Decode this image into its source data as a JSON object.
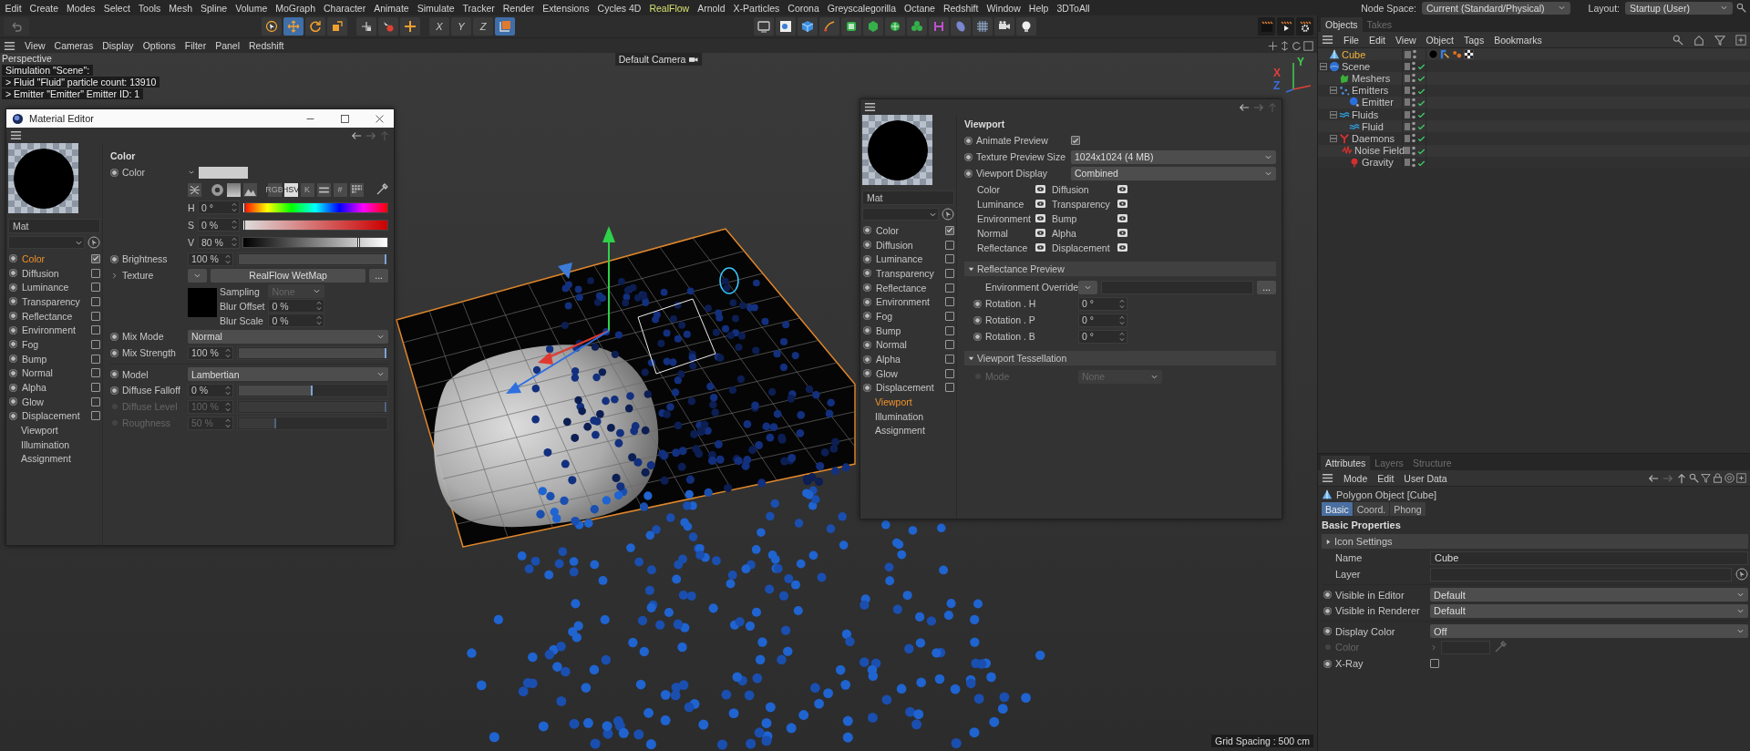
{
  "menu_bar": {
    "items": [
      {
        "label": "Edit"
      },
      {
        "label": "Create"
      },
      {
        "label": "Modes"
      },
      {
        "label": "Select"
      },
      {
        "label": "Tools"
      },
      {
        "label": "Mesh"
      },
      {
        "label": "Spline"
      },
      {
        "label": "Volume"
      },
      {
        "label": "MoGraph"
      },
      {
        "label": "Character"
      },
      {
        "label": "Animate"
      },
      {
        "label": "Simulate"
      },
      {
        "label": "Tracker"
      },
      {
        "label": "Render"
      },
      {
        "label": "Extensions"
      },
      {
        "label": "Cycles 4D"
      },
      {
        "label": "RealFlow",
        "highlighted": true
      },
      {
        "label": "Arnold"
      },
      {
        "label": "X-Particles"
      },
      {
        "label": "Corona"
      },
      {
        "label": "Greyscalegorilla"
      },
      {
        "label": "Octane"
      },
      {
        "label": "Redshift"
      },
      {
        "label": "Window"
      },
      {
        "label": "Help"
      },
      {
        "label": "3DToAll"
      }
    ],
    "node_space": {
      "label": "Node Space:",
      "value": "Current (Standard/Physical)"
    },
    "layout": {
      "label": "Layout:",
      "value": "Startup (User)"
    }
  },
  "toolbar": {
    "tools": [
      {
        "kind": "select",
        "selected": false
      },
      {
        "kind": "move",
        "selected": true
      },
      {
        "kind": "rotate",
        "selected": false
      },
      {
        "kind": "scale",
        "selected": false
      }
    ],
    "axis_locks": [
      {
        "label": "X",
        "selected": false
      },
      {
        "label": "Y",
        "selected": false
      },
      {
        "label": "Z",
        "selected": false
      }
    ],
    "coordinate_system": {
      "selected": true
    }
  },
  "viewport": {
    "menu": [
      "View",
      "Cameras",
      "Display",
      "Options",
      "Filter",
      "Panel",
      "Redshift"
    ],
    "view_name": "Perspective",
    "hud_lines": [
      "Simulation \"Scene\":",
      "> Fluid \"Fluid\" particle count: 13910",
      "> Emitter \"Emitter\" Emitter ID: 1"
    ],
    "camera": "Default Camera",
    "grid_spacing": "Grid Spacing : 500 cm",
    "axis_labels": [
      {
        "label": "Y",
        "color": "#3fcf4f"
      },
      {
        "label": "X",
        "color": "#e0403a"
      },
      {
        "label": "Z",
        "color": "#3b6fe0"
      }
    ]
  },
  "material_editor": {
    "title": "Material Editor",
    "preview_name": "Mat",
    "channels": [
      {
        "kind": "channel",
        "label": "Color",
        "checked": true,
        "selected": true
      },
      {
        "kind": "channel",
        "label": "Diffusion",
        "checked": false,
        "selected": false
      },
      {
        "kind": "channel",
        "label": "Luminance",
        "checked": false,
        "selected": false
      },
      {
        "kind": "channel",
        "label": "Transparency",
        "checked": false,
        "selected": false
      },
      {
        "kind": "channel",
        "label": "Reflectance",
        "checked": false,
        "selected": false
      },
      {
        "kind": "channel",
        "label": "Environment",
        "checked": false,
        "selected": false
      },
      {
        "kind": "channel",
        "label": "Fog",
        "checked": false,
        "selected": false
      },
      {
        "kind": "channel",
        "label": "Bump",
        "checked": false,
        "selected": false
      },
      {
        "kind": "channel",
        "label": "Normal",
        "checked": false,
        "selected": false
      },
      {
        "kind": "channel",
        "label": "Alpha",
        "checked": false,
        "selected": false
      },
      {
        "kind": "channel",
        "label": "Glow",
        "checked": false,
        "selected": false
      },
      {
        "kind": "channel",
        "label": "Displacement",
        "checked": false,
        "selected": false
      },
      {
        "kind": "page",
        "label": "Viewport",
        "selected": false
      },
      {
        "kind": "page",
        "label": "Illumination",
        "selected": false
      },
      {
        "kind": "page",
        "label": "Assignment",
        "selected": false
      }
    ],
    "section_title": "Color",
    "color": {
      "label": "Color",
      "modes": [
        {
          "label": "RGB",
          "selected": false
        },
        {
          "label": "HSV",
          "selected": true
        },
        {
          "label": "K",
          "selected": false
        },
        {
          "label": "#",
          "selected": false
        }
      ],
      "hsv": [
        {
          "label": "H",
          "value": "0 °",
          "level": 0
        },
        {
          "label": "S",
          "value": "0 %",
          "level": 0
        },
        {
          "label": "V",
          "value": "80 %",
          "level": 0.8
        }
      ]
    },
    "params": [
      {
        "kind": "slider",
        "label": "Brightness",
        "value": "100 %",
        "level": 1,
        "disabled": false
      },
      {
        "kind": "texture",
        "label": "Texture",
        "value": "RealFlow WetMap",
        "browse_label": "...",
        "sampling": {
          "label": "Sampling",
          "value": "None"
        },
        "blur": [
          {
            "label": "Blur Offset",
            "value": "0 %"
          },
          {
            "label": "Blur Scale",
            "value": "0 %"
          }
        ]
      },
      {
        "kind": "dropdown",
        "label": "Mix Mode",
        "value": "Normal",
        "disabled": false
      },
      {
        "kind": "slider",
        "label": "Mix Strength",
        "value": "100 %",
        "level": 1,
        "disabled": false
      },
      {
        "kind": "dropdown",
        "label": "Model",
        "value": "Lambertian",
        "disabled": false,
        "divider_above": true
      },
      {
        "kind": "slider",
        "label": "Diffuse Falloff",
        "value": "0 %",
        "level": 0.5,
        "disabled": false
      },
      {
        "kind": "slider",
        "label": "Diffuse Level",
        "value": "100 %",
        "level": 1,
        "disabled": true
      },
      {
        "kind": "slider",
        "label": "Roughness",
        "value": "50 %",
        "level": 0.25,
        "disabled": true
      }
    ]
  },
  "material_panel": {
    "preview_name": "Mat",
    "channels": [
      {
        "kind": "channel",
        "label": "Color",
        "checked": true,
        "selected": false
      },
      {
        "kind": "channel",
        "label": "Diffusion",
        "checked": false,
        "selected": false
      },
      {
        "kind": "channel",
        "label": "Luminance",
        "checked": false,
        "selected": false
      },
      {
        "kind": "channel",
        "label": "Transparency",
        "checked": false,
        "selected": false
      },
      {
        "kind": "channel",
        "label": "Reflectance",
        "checked": false,
        "selected": false
      },
      {
        "kind": "channel",
        "label": "Environment",
        "checked": false,
        "selected": false
      },
      {
        "kind": "channel",
        "label": "Fog",
        "checked": false,
        "selected": false
      },
      {
        "kind": "channel",
        "label": "Bump",
        "checked": false,
        "selected": false
      },
      {
        "kind": "channel",
        "label": "Normal",
        "checked": false,
        "selected": false
      },
      {
        "kind": "channel",
        "label": "Alpha",
        "checked": false,
        "selected": false
      },
      {
        "kind": "channel",
        "label": "Glow",
        "checked": false,
        "selected": false
      },
      {
        "kind": "channel",
        "label": "Displacement",
        "checked": false,
        "selected": false
      },
      {
        "kind": "page",
        "label": "Viewport",
        "selected": true
      },
      {
        "kind": "page",
        "label": "Illumination",
        "selected": false
      },
      {
        "kind": "page",
        "label": "Assignment",
        "selected": false
      }
    ],
    "section_title": "Viewport",
    "params": [
      {
        "kind": "checkbox",
        "label": "Animate Preview",
        "checked": true
      },
      {
        "kind": "dropdown",
        "label": "Texture Preview Size",
        "value": "1024x1024 (4 MB)",
        "disabled": false
      },
      {
        "kind": "dropdown",
        "label": "Viewport Display",
        "value": "Combined",
        "disabled": false
      }
    ],
    "visibility": [
      {
        "label": "Color",
        "visible": true
      },
      {
        "label": "Diffusion",
        "visible": true
      },
      {
        "label": "Luminance",
        "visible": true
      },
      {
        "label": "Transparency",
        "visible": true
      },
      {
        "label": "Environment",
        "visible": true
      },
      {
        "label": "Bump",
        "visible": true
      },
      {
        "label": "Normal",
        "visible": true
      },
      {
        "label": "Alpha",
        "visible": true
      },
      {
        "label": "Reflectance",
        "visible": true
      },
      {
        "label": "Displacement",
        "visible": true
      }
    ],
    "groups": [
      {
        "title": "Reflectance Preview",
        "expanded": true,
        "rows": [
          {
            "kind": "link",
            "label": "Environment Override",
            "browse_label": "..."
          },
          {
            "kind": "number",
            "label": "Rotation . H",
            "value": "0 °"
          },
          {
            "kind": "number",
            "label": "Rotation . P",
            "value": "0 °"
          },
          {
            "kind": "number",
            "label": "Rotation . B",
            "value": "0 °"
          }
        ]
      },
      {
        "title": "Viewport Tessellation",
        "expanded": true,
        "rows": [
          {
            "kind": "dropdown",
            "label": "Mode",
            "value": "None",
            "disabled": true
          }
        ]
      }
    ]
  },
  "objects_panel": {
    "tabs": [
      {
        "label": "Objects",
        "selected": true
      },
      {
        "label": "Takes",
        "selected": false
      }
    ],
    "menu": [
      "File",
      "Edit",
      "View",
      "Object",
      "Tags",
      "Bookmarks"
    ],
    "tree": [
      {
        "name": "Cube",
        "kind": "polygon",
        "selected": true,
        "checked": false,
        "tags": [
          {
            "kind": "material"
          },
          {
            "kind": "wetmap"
          },
          {
            "kind": "particles"
          },
          {
            "kind": "checker"
          }
        ]
      },
      {
        "name": "Scene",
        "kind": "scene",
        "selected": false,
        "checked": true,
        "expanded": true,
        "children": [
          {
            "name": "Meshers",
            "kind": "mesher",
            "selected": false,
            "checked": true
          },
          {
            "name": "Emitters",
            "kind": "emitters",
            "selected": false,
            "checked": true,
            "expanded": true,
            "children": [
              {
                "name": "Emitter",
                "kind": "emitter",
                "selected": false,
                "checked": true
              }
            ]
          },
          {
            "name": "Fluids",
            "kind": "fluids",
            "selected": false,
            "checked": true,
            "expanded": true,
            "children": [
              {
                "name": "Fluid",
                "kind": "fluid",
                "selected": false,
                "checked": true
              }
            ]
          },
          {
            "name": "Daemons",
            "kind": "daemons",
            "selected": false,
            "checked": true,
            "expanded": true,
            "children": [
              {
                "name": "Noise Field",
                "kind": "noise",
                "selected": false,
                "checked": true
              },
              {
                "name": "Gravity",
                "kind": "gravity",
                "selected": false,
                "checked": true
              }
            ]
          }
        ]
      }
    ]
  },
  "attributes_panel": {
    "tabs": [
      {
        "label": "Attributes",
        "selected": true
      },
      {
        "label": "Layers",
        "selected": false
      },
      {
        "label": "Structure",
        "selected": false
      }
    ],
    "menu": [
      "Mode",
      "Edit",
      "User Data"
    ],
    "object_title": "Polygon Object [Cube]",
    "subtabs": [
      {
        "label": "Basic",
        "selected": true
      },
      {
        "label": "Coord.",
        "selected": false
      },
      {
        "label": "Phong",
        "selected": false
      }
    ],
    "section_title": "Basic Properties",
    "group": {
      "title": "Icon Settings",
      "expanded": false
    },
    "rows": [
      {
        "kind": "text",
        "label": "Name",
        "value": "Cube"
      },
      {
        "kind": "link",
        "label": "Layer"
      },
      {
        "kind": "dropdown",
        "label": "Visible in Editor",
        "value": "Default",
        "disabled": false,
        "divider_above": true
      },
      {
        "kind": "dropdown",
        "label": "Visible in Renderer",
        "value": "Default",
        "disabled": false
      },
      {
        "kind": "dropdown",
        "label": "Display Color",
        "value": "Off",
        "disabled": false,
        "divider_above": true
      },
      {
        "kind": "color",
        "label": "Color",
        "disabled": true
      },
      {
        "kind": "checkbox",
        "label": "X-Ray",
        "checked": false
      }
    ]
  }
}
